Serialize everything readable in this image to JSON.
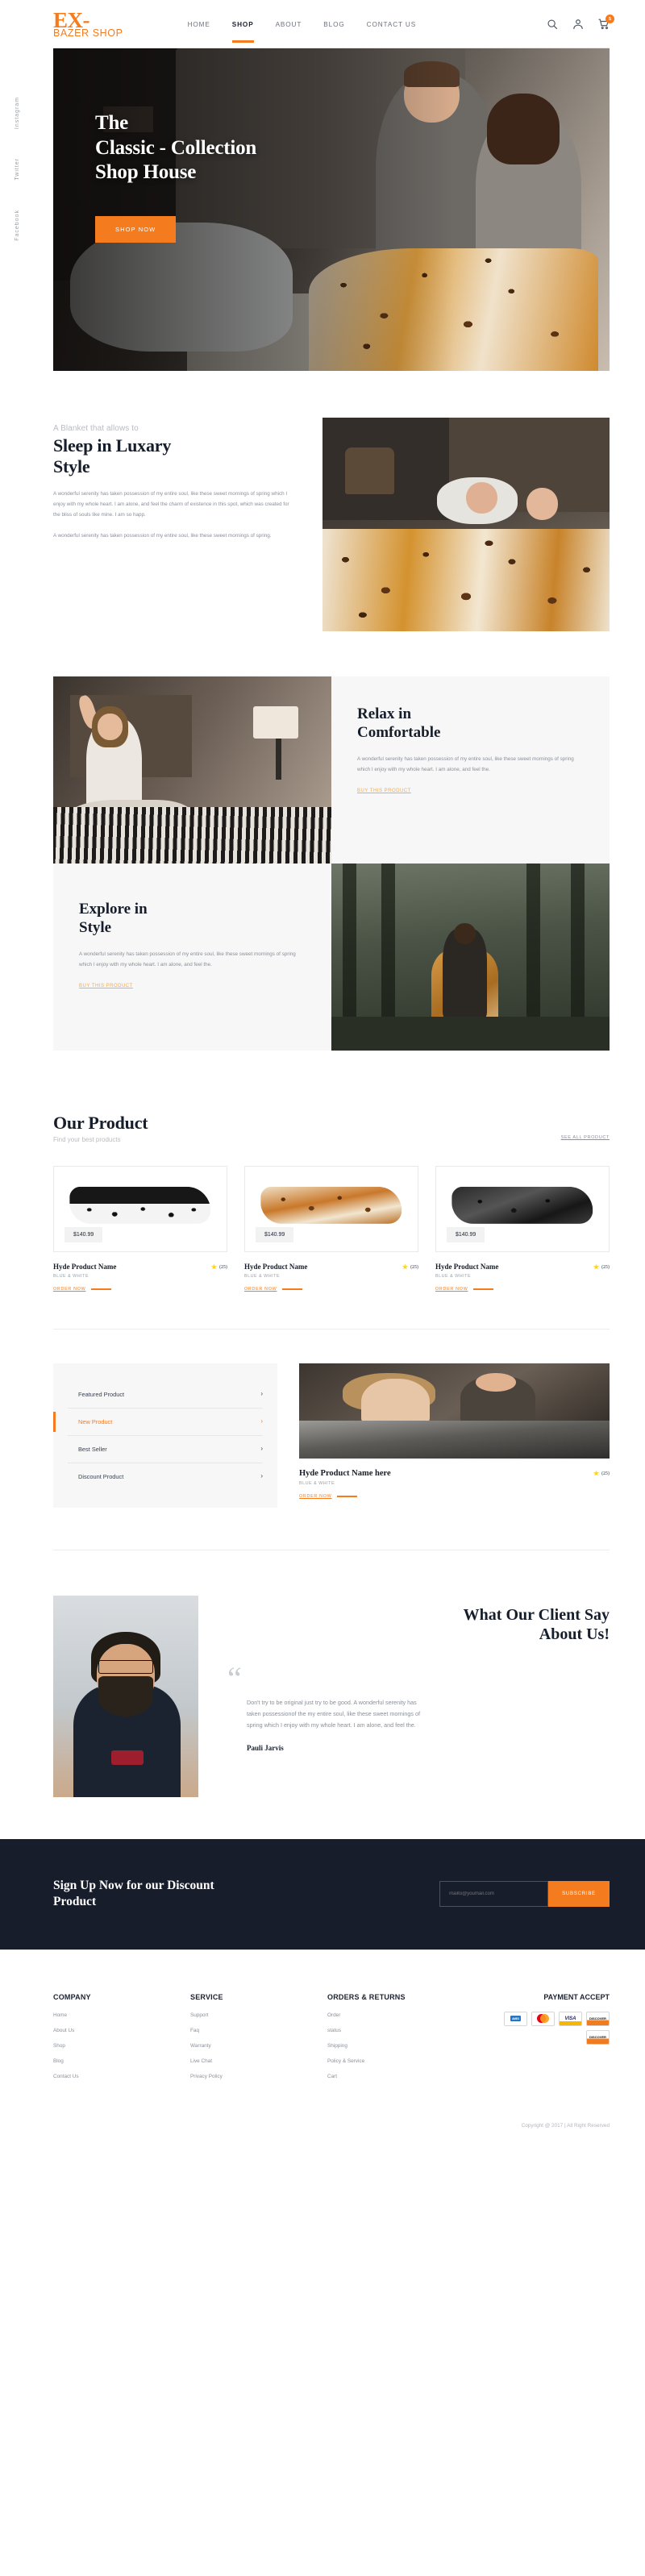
{
  "header": {
    "logo_top": "EX-",
    "logo_bottom": "BAZER SHOP",
    "nav": [
      {
        "label": "HOME",
        "active": false
      },
      {
        "label": "SHOP",
        "active": true
      },
      {
        "label": "ABOUT",
        "active": false
      },
      {
        "label": "BLOG",
        "active": false
      },
      {
        "label": "CONTACT US",
        "active": false
      }
    ],
    "cart_count": "5"
  },
  "social": [
    "Instagram",
    "Twitter",
    "Facebook"
  ],
  "hero": {
    "title_line1": "The",
    "title_line2": "Classic - Collection",
    "title_line3": "Shop House",
    "button": "SHOP NOW"
  },
  "sleep": {
    "eyebrow": "A Blanket that allows to",
    "title_line1": "Sleep in Luxary",
    "title_line2": "Style",
    "paragraph1": "A wonderful serenity has taken possession of my entire soul, like these sweet mornings of spring which I enjoy with my whole heart. I am alone, and feel the charm of existence in this spot, which was created for the bliss of souls like mine. I am so happ.",
    "paragraph2": "A wonderful serenity has taken possession of my entire soul, like these sweet mornings of spring."
  },
  "relax": {
    "title_line1": "Relax in",
    "title_line2": "Comfortable",
    "paragraph": "A wonderful serenity has taken possession of my entire soul, like these sweet mornings of spring which I enjoy with my whole heart. I am alone, and feel the.",
    "link": "BUY THIS PRODUCT"
  },
  "explore": {
    "title_line1": "Explore in",
    "title_line2": "Style",
    "paragraph": "A wonderful serenity has taken possession of my entire soul, like these sweet mornings of spring which I enjoy with my whole heart. I am alone, and feel the.",
    "link": "BUY THIS PRODUCT"
  },
  "our_product": {
    "title": "Our Product",
    "subtitle": "Find your best products",
    "see_all": "SEE ALL PRODUCT",
    "items": [
      {
        "price": "$140.99",
        "name": "Hyde Product Name",
        "color": "BLUE & WHITE",
        "rating_count": "(25)",
        "order_label": "ORDER NOW"
      },
      {
        "price": "$140.99",
        "name": "Hyde Product Name",
        "color": "BLUE & WHITE",
        "rating_count": "(25)",
        "order_label": "ORDER NOW"
      },
      {
        "price": "$140.99",
        "name": "Hyde Product Name",
        "color": "BLUE & WHITE",
        "rating_count": "(25)",
        "order_label": "ORDER NOW"
      }
    ]
  },
  "categories": [
    {
      "label": "Featured Product",
      "active": false
    },
    {
      "label": "New Product",
      "active": true
    },
    {
      "label": "Best Seller",
      "active": false
    },
    {
      "label": "Discount Product",
      "active": false
    }
  ],
  "featured": {
    "name": "Hyde Product Name here",
    "color": "BLUE & WHITE",
    "rating_count": "(25)",
    "order_label": "ORDER NOW"
  },
  "testimonial": {
    "title_line1": "What Our Client Say",
    "title_line2": "About Us!",
    "quote_glyph": "“",
    "text": "Don't try to be original just try to be good. A wonderful serenity has taken possessionof the my entire soul, like these sweet mornings of spring which I enjoy with my whole heart. I am alone, and feel the.",
    "author": "Pauli Jarvis"
  },
  "newsletter": {
    "title_line1": "Sign Up Now for our Discount",
    "title_line2": "Product",
    "placeholder": "mailto@youmail.com",
    "button": "SUBSCRIBE"
  },
  "footer": {
    "columns": [
      {
        "heading": "COMPANY",
        "links": [
          "Home",
          "About Us",
          "Shop",
          "Blog",
          "Contact Us"
        ]
      },
      {
        "heading": "SERVICE",
        "links": [
          "Support",
          "Faq",
          "Warranty",
          "Live Chat",
          "Privacy Policy"
        ]
      },
      {
        "heading": "ORDERS & RETURNS",
        "links": [
          "Order",
          "status",
          "Shipping",
          "Policy & Service",
          "Cart"
        ]
      }
    ],
    "payment_heading": "PAYMENT ACCEPT",
    "payment_cards": [
      "AMERICAN EXPRESS",
      "MasterCard",
      "VISA",
      "DISCOVER",
      "DISCOVER"
    ],
    "copyright": "Copyright @ 2017 | All Right Reserved"
  },
  "colors": {
    "accent": "#F57B1F",
    "dark": "#171d2b",
    "muted": "#8a8f99",
    "star": "#FFD21E"
  }
}
